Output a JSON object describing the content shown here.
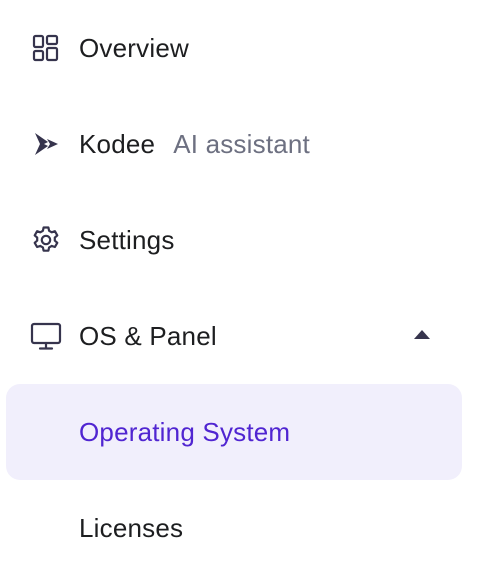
{
  "nav": {
    "items": [
      {
        "label": "Overview",
        "icon": "overview-grid-icon"
      },
      {
        "label": "Kodee",
        "sublabel": "AI assistant",
        "icon": "kodee-icon"
      },
      {
        "label": "Settings",
        "icon": "gear-icon"
      },
      {
        "label": "OS & Panel",
        "icon": "monitor-icon",
        "expanded": true,
        "caret_icon": "caret-up-icon"
      }
    ],
    "subitems": [
      {
        "label": "Operating System",
        "active": true
      },
      {
        "label": "Licenses",
        "active": false
      }
    ]
  },
  "colors": {
    "text": "#1d1e20",
    "muted": "#6d7081",
    "icon": "#36344d",
    "active_text": "#5025d1",
    "active_bg": "#f1effc"
  }
}
